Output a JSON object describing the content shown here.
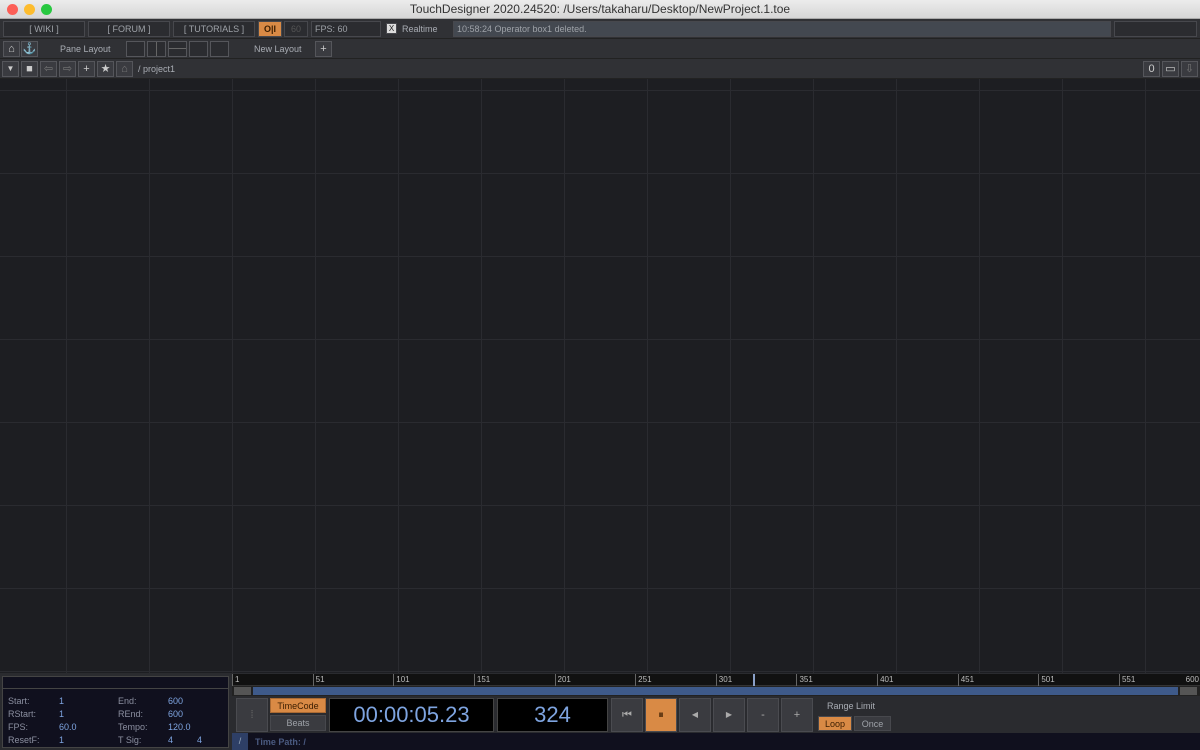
{
  "window": {
    "title": "TouchDesigner 2020.24520: /Users/takaharu/Desktop/NewProject.1.toe"
  },
  "toolbar": {
    "wiki": "[ WIKI ]",
    "forum": "[ FORUM ]",
    "tutorials": "[ TUTORIALS ]",
    "perform": "O|I",
    "fps_cap": "60",
    "fps_label": "FPS:  60",
    "realtime_check": "X",
    "realtime": "Realtime",
    "status": "10:58:24 Operator box1 deleted."
  },
  "pane": {
    "pane_layout": "Pane Layout",
    "new_layout": "New Layout",
    "add": "+"
  },
  "path": {
    "current": "/ project1",
    "counter": "0"
  },
  "timeline": {
    "info": {
      "start_l": "Start:",
      "start": "1",
      "end_l": "End:",
      "end": "600",
      "rstart_l": "RStart:",
      "rstart": "1",
      "rend_l": "REnd:",
      "rend": "600",
      "fps_l": "FPS:",
      "fps": "60.0",
      "tempo_l": "Tempo:",
      "tempo": "120.0",
      "resetf_l": "ResetF:",
      "resetf": "1",
      "tsig_l": "T Sig:",
      "tsig_a": "4",
      "tsig_b": "4"
    },
    "ruler_ticks": [
      "1",
      "51",
      "101",
      "151",
      "201",
      "251",
      "301",
      "351",
      "401",
      "451",
      "501",
      "551",
      "600"
    ],
    "range": [
      1,
      600
    ],
    "current_frame_value": 324,
    "timecode": "TimeCode",
    "beats": "Beats",
    "timecode_display": "00:00:05.23",
    "frame_display": "324",
    "range_limit": "Range Limit",
    "loop": "Loop",
    "once": "Once",
    "minus": "-",
    "plus": "+",
    "time_path": "Time Path: /",
    "root": "/"
  },
  "colors": {
    "accent": "#d98a45",
    "value": "#7ea4e0"
  }
}
